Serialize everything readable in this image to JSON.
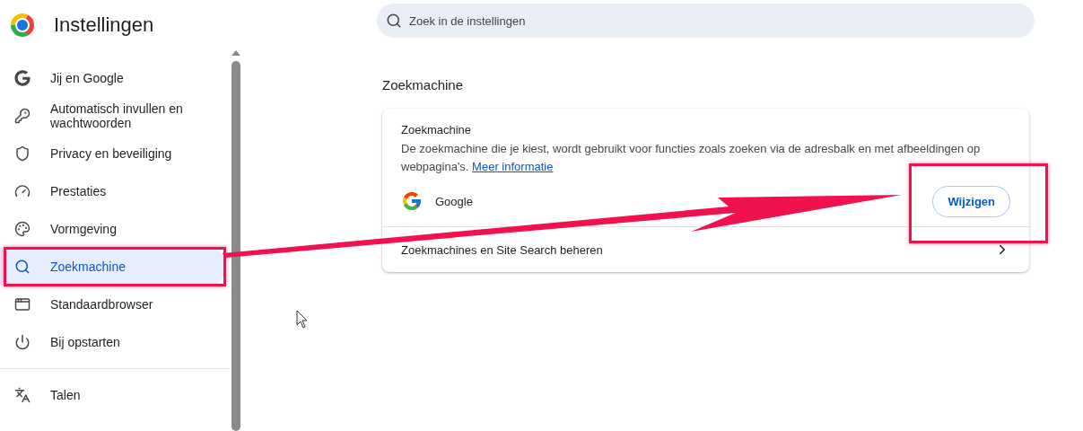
{
  "header": {
    "title": "Instellingen"
  },
  "search": {
    "placeholder": "Zoek in de instellingen"
  },
  "sidebar": {
    "items": [
      {
        "kind": "google",
        "label": "Jij en Google",
        "selected": false
      },
      {
        "kind": "key",
        "label": "Automatisch invullen en wachtwoorden",
        "selected": false
      },
      {
        "kind": "shield",
        "label": "Privacy en beveiliging",
        "selected": false
      },
      {
        "kind": "gauge",
        "label": "Prestaties",
        "selected": false
      },
      {
        "kind": "palette",
        "label": "Vormgeving",
        "selected": false
      },
      {
        "kind": "search",
        "label": "Zoekmachine",
        "selected": true
      },
      {
        "kind": "browser",
        "label": "Standaardbrowser",
        "selected": false
      },
      {
        "kind": "power",
        "label": "Bij opstarten",
        "selected": false
      },
      {
        "kind": "divider"
      },
      {
        "kind": "languages",
        "label": "Talen",
        "selected": false
      }
    ]
  },
  "section": {
    "title": "Zoekmachine",
    "card": {
      "title": "Zoekmachine",
      "description": "De zoekmachine die je kiest, wordt gebruikt voor functies zoals zoeken via de adresbalk en met afbeeldingen op webpagina's.",
      "link": "Meer informatie",
      "engine": "Google",
      "button": "Wijzigen",
      "manage": "Zoekmachines en Site Search beheren"
    }
  }
}
